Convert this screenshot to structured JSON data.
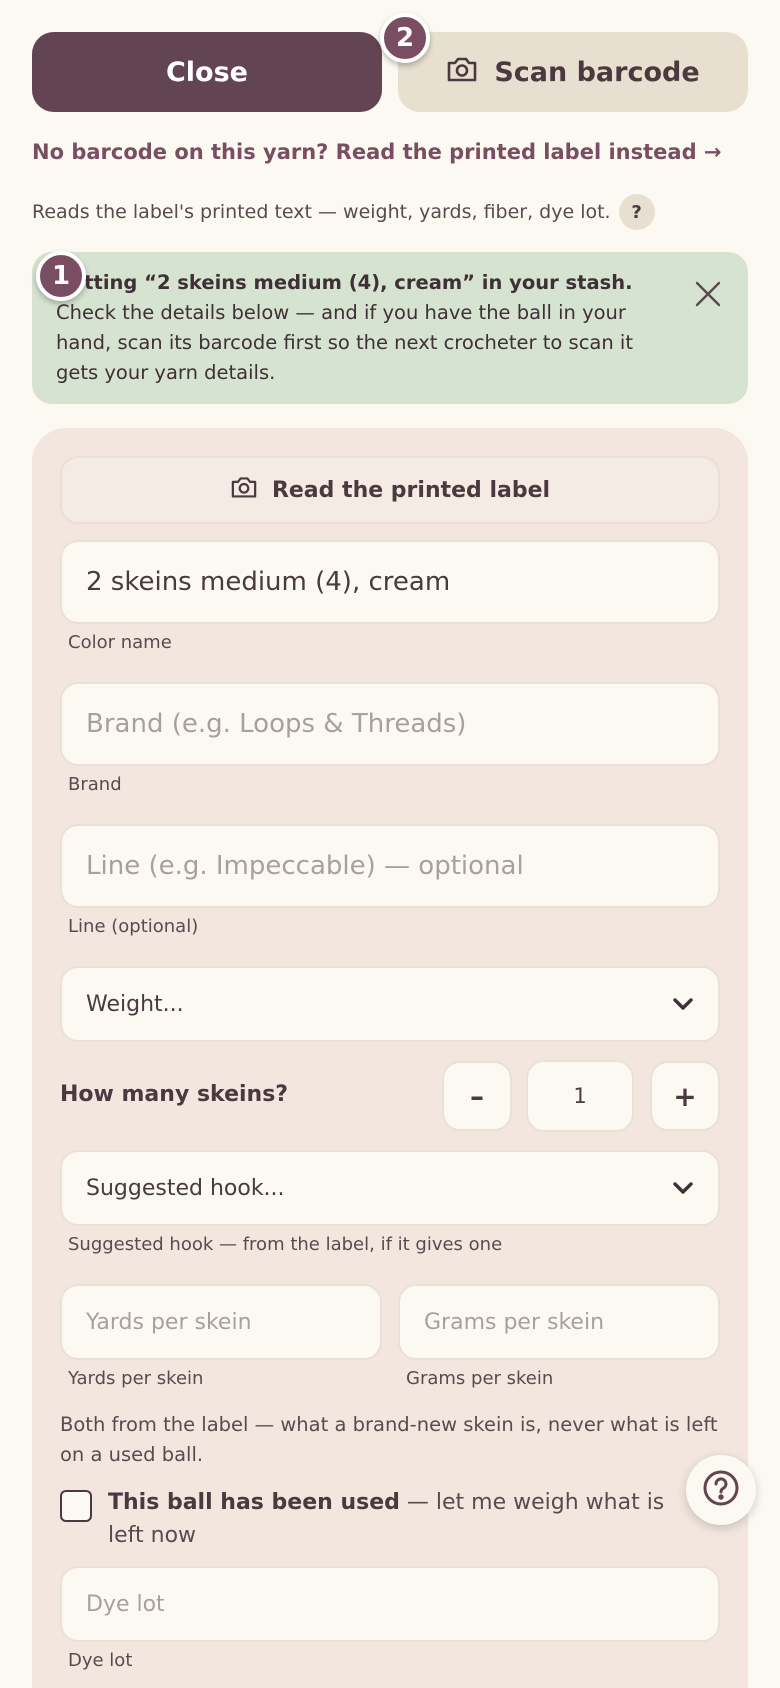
{
  "top": {
    "close_label": "Close",
    "scan_label": "Scan barcode",
    "badge_1": "1",
    "badge_2": "2"
  },
  "no_barcode_link": "No barcode on this yarn? Read the printed label instead →",
  "reads_text": "Reads the label's printed text — weight, yards, fiber, dye lot.",
  "help_mini": "?",
  "notice": {
    "bold": "Putting “2 skeins medium (4), cream” in your stash.",
    "rest": " Check the details below — and if you have the ball in your hand, scan its barcode first so the next crocheter to scan it gets your yarn details.",
    "close": "×"
  },
  "form": {
    "read_label_button": "Read the printed label",
    "color_value": "2 skeins medium (4), cream",
    "color_caption": "Color name",
    "brand_placeholder": "Brand (e.g. Loops & Threads)",
    "brand_caption": "Brand",
    "line_placeholder": "Line (e.g. Impeccable) — optional",
    "line_caption": "Line (optional)",
    "weight_select": "Weight...",
    "skeins_label": "How many skeins?",
    "skeins_minus": "–",
    "skeins_value": "1",
    "skeins_plus": "+",
    "hook_select": "Suggested hook...",
    "hook_caption": "Suggested hook — from the label, if it gives one",
    "yards_placeholder": "Yards per skein",
    "yards_caption": "Yards per skein",
    "grams_placeholder": "Grams per skein",
    "grams_caption": "Grams per skein",
    "both_note": "Both from the label — what a brand-new skein is, never what is left on a used ball.",
    "used_bold": "This ball has been used",
    "used_rest": " — let me weigh what is left now",
    "dye_placeholder": "Dye lot",
    "dye_caption": "Dye lot"
  },
  "colors": {
    "primary": "#634452",
    "accent": "#7a4e62",
    "notice_bg": "#d6e3d1",
    "card_bg": "#f3e6df",
    "page_bg": "#fcf9f3"
  },
  "icons": [
    "camera-icon",
    "close-icon",
    "chevron-down-icon",
    "help-icon"
  ]
}
